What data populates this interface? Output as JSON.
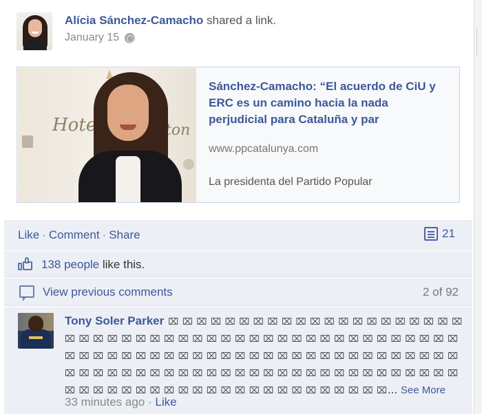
{
  "post": {
    "author": "Alícia Sánchez-Camacho",
    "action": "shared a link.",
    "date": "January 15",
    "privacy_icon": "globe-icon"
  },
  "link": {
    "thumbnail_text_1": "Hotel",
    "thumbnail_text_2": "ton",
    "title": "Sánchez-Camacho: “El acuerdo de CiU y ERC es un camino hacia la nada perjudicial para Cataluña y par",
    "domain": "www.ppcatalunya.com",
    "description": "La presidenta del Partido Popular"
  },
  "actions": {
    "like": "Like",
    "comment": "Comment",
    "share": "Share",
    "separator": "·",
    "comment_count": "21"
  },
  "likes": {
    "count_text": "138 people",
    "suffix": " like this."
  },
  "previous": {
    "label": "View previous comments",
    "pagination": "2 of 92"
  },
  "comment": {
    "author": "Tony Soler Parker",
    "text": "⌧ ⌧ ⌧ ⌧ ⌧ ⌧ ⌧ ⌧ ⌧ ⌧ ⌧ ⌧ ⌧ ⌧ ⌧ ⌧ ⌧ ⌧ ⌧ ⌧ ⌧ ⌧ ⌧ ⌧ ⌧ ⌧ ⌧ ⌧ ⌧ ⌧ ⌧ ⌧ ⌧ ⌧ ⌧ ⌧ ⌧ ⌧ ⌧ ⌧ ⌧ ⌧ ⌧ ⌧ ⌧ ⌧ ⌧ ⌧ ⌧ ⌧ ⌧ ⌧ ⌧ ⌧ ⌧ ⌧ ⌧ ⌧ ⌧ ⌧ ⌧ ⌧ ⌧ ⌧ ⌧ ⌧ ⌧ ⌧ ⌧ ⌧ ⌧ ⌧ ⌧ ⌧ ⌧ ⌧ ⌧ ⌧ ⌧ ⌧ ⌧ ⌧ ⌧ ⌧ ⌧ ⌧ ⌧ ⌧ ⌧ ⌧ ⌧ ⌧ ⌧ ⌧ ⌧ ⌧ ⌧ ⌧ ⌧ ⌧ ⌧ ⌧ ⌧ ⌧ ⌧ ⌧ ⌧ ⌧ ⌧ ⌧ ⌧ ⌧ ⌧ ⌧ ⌧ ⌧ ⌧ ⌧ ⌧ ⌧ ⌧ ⌧ ⌧ ⌧ ⌧ ⌧ ⌧ ⌧",
    "ellipsis": "... ",
    "see_more": "See More",
    "time": "33 minutes ago",
    "separator": " · ",
    "like": "Like"
  },
  "colors": {
    "link_blue": "#3b5998",
    "feedback_bg": "#eceff5"
  }
}
